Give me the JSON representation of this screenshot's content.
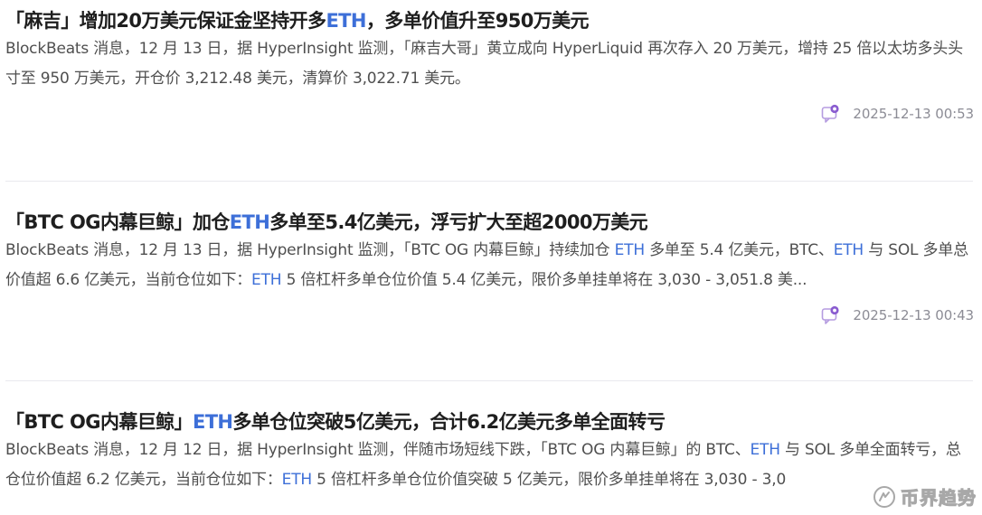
{
  "articles": [
    {
      "title_parts": [
        "「麻吉」增加20万美元保证金坚持开多",
        "ETH",
        "，多单价值升至950万美元"
      ],
      "summary_parts": [
        "BlockBeats 消息，12 月 13 日，据 HyperInsight 监测，「麻吉大哥」黄立成向 HyperLiquid 再次存入 20 万美元，增持 25 倍以太坊多头头寸至 950 万美元，开仓价 3,212.48 美元，清算价 3,022.71 美元。"
      ],
      "timestamp": "2025-12-13 00:53"
    },
    {
      "title_parts": [
        "「BTC OG内幕巨鲸」加仓",
        "ETH",
        "多单至5.4亿美元，浮亏扩大至超2000万美元"
      ],
      "summary_parts": [
        "BlockBeats 消息，12 月 13 日，据 HyperInsight 监测，「BTC OG 内幕巨鲸」持续加仓 ",
        "ETH",
        " 多单至 5.4 亿美元，BTC、",
        "ETH",
        " 与 SOL 多单总价值超 6.6 亿美元，当前仓位如下：",
        "ETH",
        " 5 倍杠杆多单仓位价值 5.4 亿美元，限价多单挂单将在 3,030 - 3,051.8 美..."
      ],
      "timestamp": "2025-12-13 00:43"
    },
    {
      "title_parts": [
        "「BTC OG内幕巨鲸」",
        "ETH",
        "多单仓位突破5亿美元，合计6.2亿美元多单全面转亏"
      ],
      "summary_parts": [
        "BlockBeats 消息，12 月 12 日，据 HyperInsight 监测，伴随市场短线下跌，「BTC OG 内幕巨鲸」的 BTC、",
        "ETH",
        " 与 SOL 多单全面转亏，总仓位价值超 6.2 亿美元，当前仓位如下：",
        "ETH",
        " 5 倍杠杆多单仓位价值突破 5 亿美元，限价多单挂单将在 3,030 - 3,0"
      ]
    }
  ],
  "watermark": {
    "text": "币界趋势"
  },
  "colors": {
    "accent": "#3d6fd8",
    "title": "#1e1e1e",
    "body": "#4f4f4f",
    "meta": "#8c8c95",
    "icon": "#a57bd8"
  },
  "icons": {
    "comment": "comment-bubble-icon",
    "watermark": "watermark-logo-icon"
  }
}
